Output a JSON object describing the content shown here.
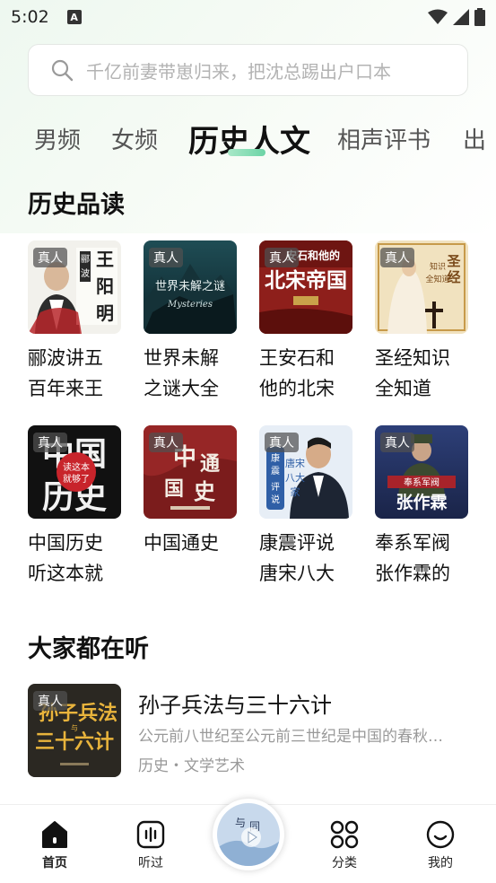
{
  "status": {
    "time": "5:02"
  },
  "search": {
    "placeholder": "千亿前妻带崽归来，把沈总踢出户口本"
  },
  "tabs": [
    "男频",
    "女频",
    "历史人文",
    "相声评书",
    "出"
  ],
  "sections": {
    "history": {
      "title": "历史品读"
    },
    "popular": {
      "title": "大家都在听"
    }
  },
  "badge": "真人",
  "history_books": [
    {
      "title": "郦波讲五百年来王",
      "cover_text": "王阳明"
    },
    {
      "title": "世界未解之谜大全",
      "cover_text": "世界未解之谜"
    },
    {
      "title": "王安石和他的北宋",
      "cover_text": "北宋帝国"
    },
    {
      "title": "圣经知识全知道",
      "cover_text": "圣经"
    },
    {
      "title": "中国历史听这本就",
      "cover_text": "中国历史"
    },
    {
      "title": "中国通史",
      "cover_text": "中国通史"
    },
    {
      "title": "康震评说唐宋八大",
      "cover_text": "康震评说"
    },
    {
      "title": "奉系军阀张作霖的",
      "cover_text": "张作霖"
    }
  ],
  "popular_item": {
    "title": "孙子兵法与三十六计",
    "description": "公元前八世纪至公元前三世纪是中国的春秋…",
    "tags": "历史・文学艺术",
    "cover_text": "孙子兵法 三十六计"
  },
  "nav": [
    {
      "label": "首页",
      "icon": "home-icon",
      "active": true
    },
    {
      "label": "听过",
      "icon": "audio-wave-icon",
      "active": false
    },
    {
      "label": "分类",
      "icon": "category-grid-icon",
      "active": false
    },
    {
      "label": "我的",
      "icon": "profile-smile-icon",
      "active": false
    }
  ],
  "colors": {
    "accent": "#6cd4a6",
    "text": "#111111",
    "muted": "#999999"
  }
}
